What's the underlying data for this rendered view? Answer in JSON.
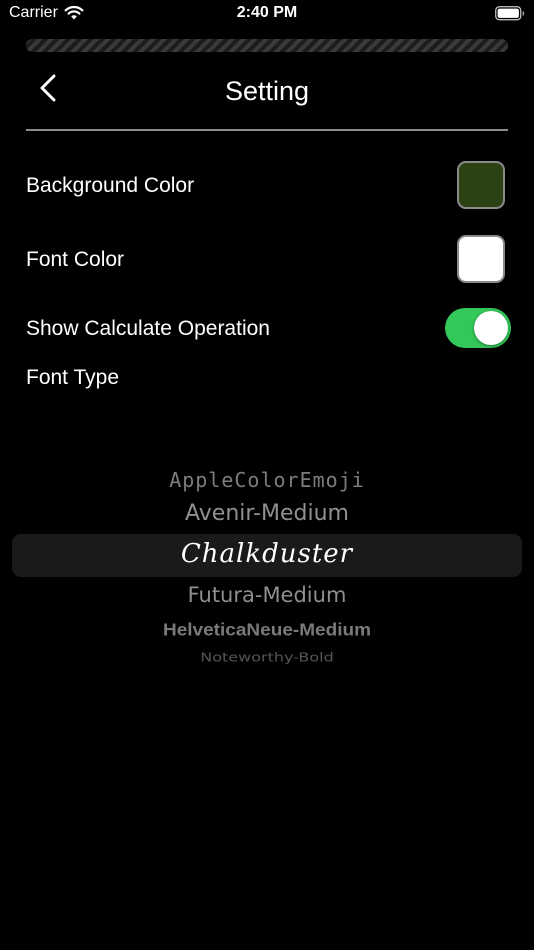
{
  "status_bar": {
    "carrier": "Carrier",
    "time": "2:40 PM",
    "wifi_icon": "wifi-icon",
    "battery_icon": "battery-icon"
  },
  "header": {
    "title": "Setting",
    "back_icon": "chevron-left-icon"
  },
  "settings": {
    "background_color": {
      "label": "Background Color",
      "value": "#2b4214"
    },
    "font_color": {
      "label": "Font Color",
      "value": "#ffffff"
    },
    "show_calculate_operation": {
      "label": "Show Calculate Operation",
      "enabled": true,
      "toggle_color": "#34c759"
    },
    "font_type": {
      "label": "Font Type",
      "selected": "Chalkduster",
      "options": [
        "AppleColorEmoji",
        "Avenir-Medium",
        "Chalkduster",
        "Futura-Medium",
        "HelveticaNeue-Medium",
        "Noteworthy-Bold"
      ]
    }
  }
}
